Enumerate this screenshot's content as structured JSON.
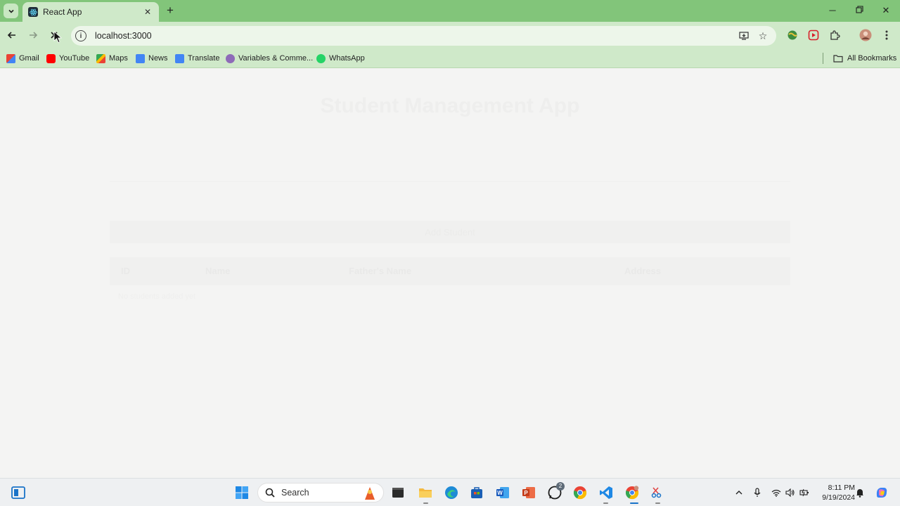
{
  "browser": {
    "tab_title": "React App",
    "url": "localhost:3000",
    "bookmarks": [
      {
        "label": "Gmail",
        "color": "#ea4335"
      },
      {
        "label": "YouTube",
        "color": "#ff0000"
      },
      {
        "label": "Maps",
        "color": "#34a853"
      },
      {
        "label": "News",
        "color": "#4285f4"
      },
      {
        "label": "Translate",
        "color": "#4285f4"
      },
      {
        "label": "Variables & Comme...",
        "color": "#8e6bb8"
      },
      {
        "label": "WhatsApp",
        "color": "#25d366"
      }
    ],
    "all_bookmarks_label": "All Bookmarks",
    "accent_color": "#82c57a"
  },
  "page": {
    "title": "Student Management App",
    "add_button_label": "Add Student",
    "columns": [
      "ID",
      "Name",
      "Father's Name",
      "Address"
    ],
    "empty_text": "No students added yet"
  },
  "taskbar": {
    "search_placeholder": "Search",
    "whatsapp_badge": "2",
    "time": "8:11 PM",
    "date": "9/19/2024"
  }
}
